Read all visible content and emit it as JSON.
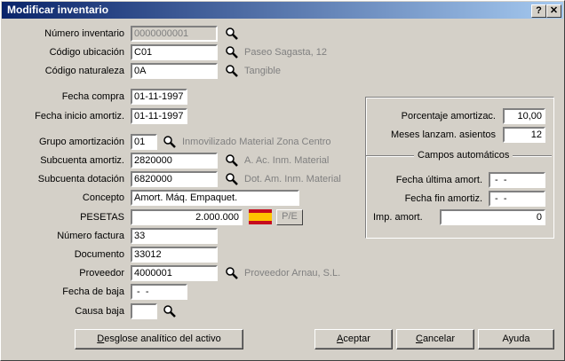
{
  "window": {
    "title": "Modificar inventario",
    "help_button": "?",
    "close_button": "✕"
  },
  "form": {
    "numero_inventario": {
      "label": "Número inventario",
      "value": "0000000001"
    },
    "codigo_ubicacion": {
      "label": "Código ubicación",
      "value": "C01",
      "desc": "Paseo Sagasta, 12"
    },
    "codigo_naturaleza": {
      "label": "Código naturaleza",
      "value": "0A",
      "desc": "Tangible"
    },
    "fecha_compra": {
      "label": "Fecha compra",
      "value": "01-11-1997"
    },
    "fecha_inicio": {
      "label": "Fecha inicio amortiz.",
      "value": "01-11-1997"
    },
    "grupo_amortizacion": {
      "label": "Grupo amortización",
      "value": "01",
      "desc": "Inmovilizado Material Zona Centro"
    },
    "subcuenta_amortiz": {
      "label": "Subcuenta amortiz.",
      "value": "2820000",
      "desc": "A. Ac. Inm. Material"
    },
    "subcuenta_dotacion": {
      "label": "Subcuenta dotación",
      "value": "6820000",
      "desc": "Dot. Am. Inm. Material"
    },
    "concepto": {
      "label": "Concepto",
      "value": "Amort. Máq. Empaquet."
    },
    "pesetas": {
      "label": "PESETAS",
      "value": "2.000.000",
      "toggle": "P/E"
    },
    "numero_factura": {
      "label": "Número factura",
      "value": "33"
    },
    "documento": {
      "label": "Documento",
      "value": "33012"
    },
    "proveedor": {
      "label": "Proveedor",
      "value": "4000001",
      "desc": "Proveedor Arnau, S.L."
    },
    "fecha_baja": {
      "label": "Fecha de baja",
      "value": " -  - "
    },
    "causa_baja": {
      "label": "Causa baja",
      "value": ""
    }
  },
  "right_panel": {
    "porcentaje": {
      "label": "Porcentaje amortizac.",
      "value": "10,00"
    },
    "meses": {
      "label": "Meses lanzam. asientos",
      "value": "12"
    },
    "group_title": "Campos automáticos",
    "fecha_ultima": {
      "label": "Fecha última amort.",
      "value": " -  - "
    },
    "fecha_fin": {
      "label": "Fecha fin amortiz.",
      "value": " -  - "
    },
    "imp_amort": {
      "label": "Imp. amort.",
      "value": "0"
    }
  },
  "buttons": {
    "desglose": {
      "first": "D",
      "rest": "esglose analítico del activo"
    },
    "aceptar": {
      "first": "A",
      "rest": "ceptar"
    },
    "cancelar": {
      "first": "C",
      "rest": "ancelar"
    },
    "ayuda": {
      "first": "",
      "rest": "Ayuda"
    }
  },
  "colors": {
    "title_start": "#0a246a",
    "title_end": "#a6caf0",
    "face": "#d4d0c8",
    "flag_red": "#c60b1e",
    "flag_yellow": "#ffc400"
  },
  "icons": {
    "lookup": "magnifier-icon",
    "flag": "spain-flag-icon"
  }
}
